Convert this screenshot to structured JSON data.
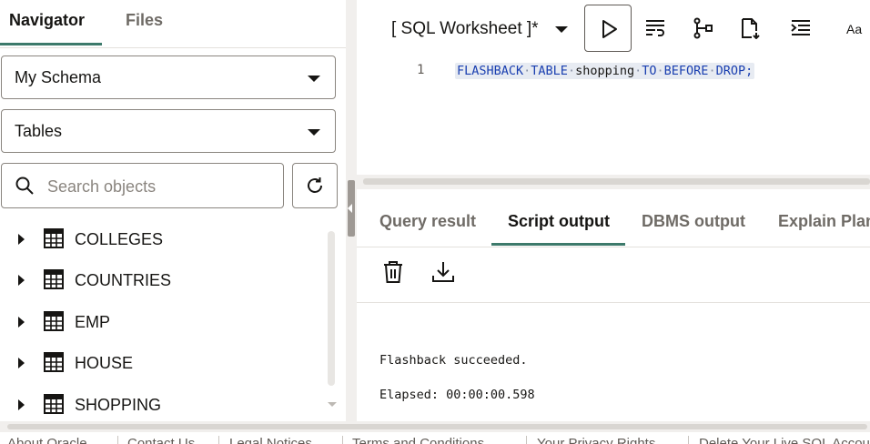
{
  "navigator": {
    "tabs": [
      "Navigator",
      "Files"
    ],
    "schema_select": "My Schema",
    "type_select": "Tables",
    "search_placeholder": "Search objects",
    "tables": [
      "COLLEGES",
      "COUNTRIES",
      "EMP",
      "HOUSE",
      "SHOPPING"
    ]
  },
  "worksheet": {
    "title": "[ SQL Worksheet ]*",
    "font_button": "Aa",
    "toolbar_icons": [
      "run-icon",
      "run-script-icon",
      "explain-plan-icon",
      "autotrace-icon",
      "format-icon"
    ]
  },
  "editor": {
    "line_number": "1",
    "tokens": [
      {
        "text": "FLASHBACK",
        "kind": "kw"
      },
      {
        "text": "·",
        "kind": "ws"
      },
      {
        "text": "TABLE",
        "kind": "kw"
      },
      {
        "text": "·",
        "kind": "ws"
      },
      {
        "text": "shopping",
        "kind": "id"
      },
      {
        "text": "·",
        "kind": "ws"
      },
      {
        "text": "TO",
        "kind": "kw"
      },
      {
        "text": "·",
        "kind": "ws"
      },
      {
        "text": "BEFORE",
        "kind": "kw"
      },
      {
        "text": "·",
        "kind": "ws"
      },
      {
        "text": "DROP;",
        "kind": "kw"
      }
    ]
  },
  "output": {
    "tabs": [
      "Query result",
      "Script output",
      "DBMS output",
      "Explain Plan"
    ],
    "active_tab": "Script output",
    "lines": [
      "Flashback succeeded.",
      "Elapsed: 00:00:00.598"
    ]
  },
  "footer": {
    "links": [
      "About Oracle",
      "Contact Us",
      "Legal Notices",
      "Terms and Conditions",
      "Your Privacy Rights",
      "Delete Your Live SQL Account"
    ]
  },
  "colors": {
    "accent": "#3d7a6b",
    "keyword": "#1a3fb0",
    "code_highlight": "#e7ebf2"
  }
}
